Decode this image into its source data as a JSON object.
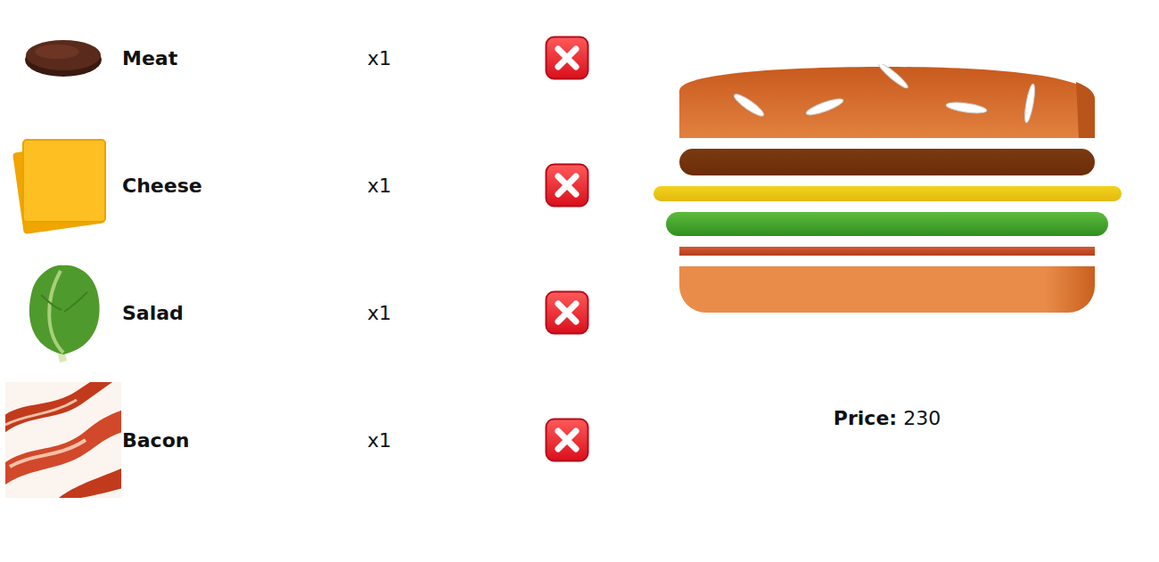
{
  "ingredients": [
    {
      "name": "Meat",
      "count": "x1",
      "kind": "meat"
    },
    {
      "name": "Cheese",
      "count": "x1",
      "kind": "cheese"
    },
    {
      "name": "Salad",
      "count": "x1",
      "kind": "salad"
    },
    {
      "name": "Bacon",
      "count": "x1",
      "kind": "bacon"
    }
  ],
  "burger": {
    "layers": [
      {
        "kind": "meat"
      },
      {
        "kind": "cheese"
      },
      {
        "kind": "salad"
      },
      {
        "kind": "bacon"
      }
    ]
  },
  "price": {
    "label": "Price:",
    "value": "230"
  }
}
